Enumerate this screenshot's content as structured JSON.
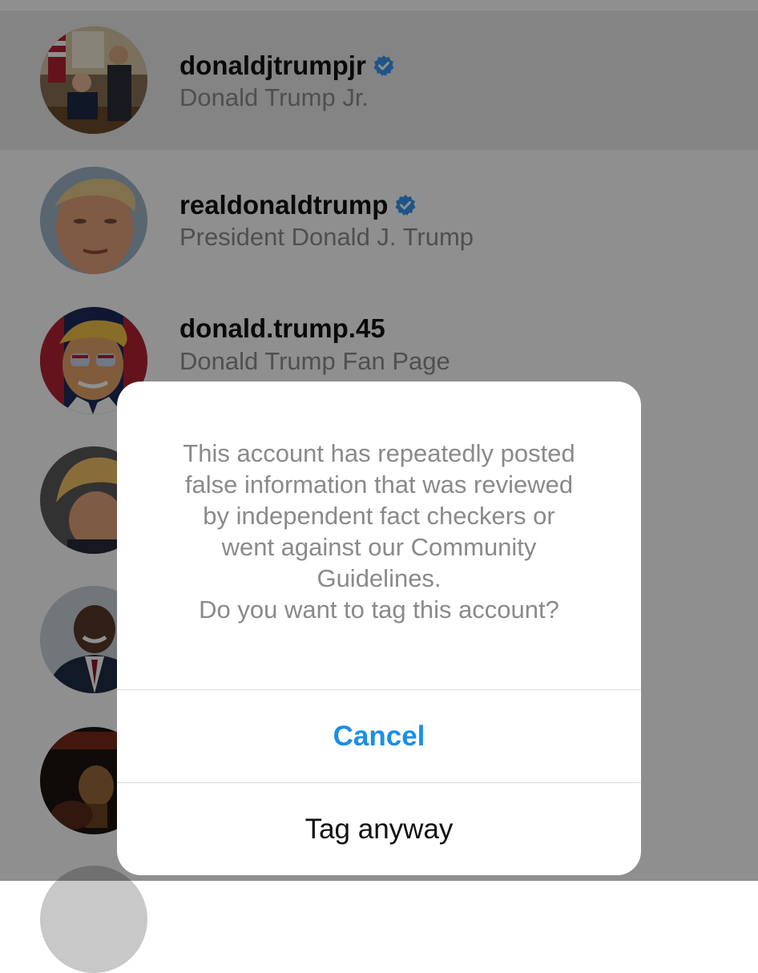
{
  "results": [
    {
      "username": "donaldjtrumpjr",
      "full_name": "Donald Trump Jr.",
      "verified": true
    },
    {
      "username": "realdonaldtrump",
      "full_name": "President Donald J. Trump",
      "verified": true
    },
    {
      "username": "donald.trump.45",
      "full_name": "Donald Trump Fan Page",
      "verified": false
    },
    {
      "username": "",
      "full_name": "",
      "verified": false
    },
    {
      "username": "",
      "full_name": "",
      "verified": false
    },
    {
      "username": "",
      "full_name": "",
      "verified": false
    }
  ],
  "dialog": {
    "message_lines": [
      "This account has repeatedly posted",
      "false information that was reviewed",
      "by independent fact checkers or",
      "went against our Community",
      "Guidelines.",
      "Do you want to tag this account?"
    ],
    "cancel_label": "Cancel",
    "tag_anyway_label": "Tag anyway"
  },
  "colors": {
    "verified_badge": "#3897f0",
    "cancel_text": "#1b8fe6",
    "overlay": "rgba(0,0,0,0.44)"
  }
}
